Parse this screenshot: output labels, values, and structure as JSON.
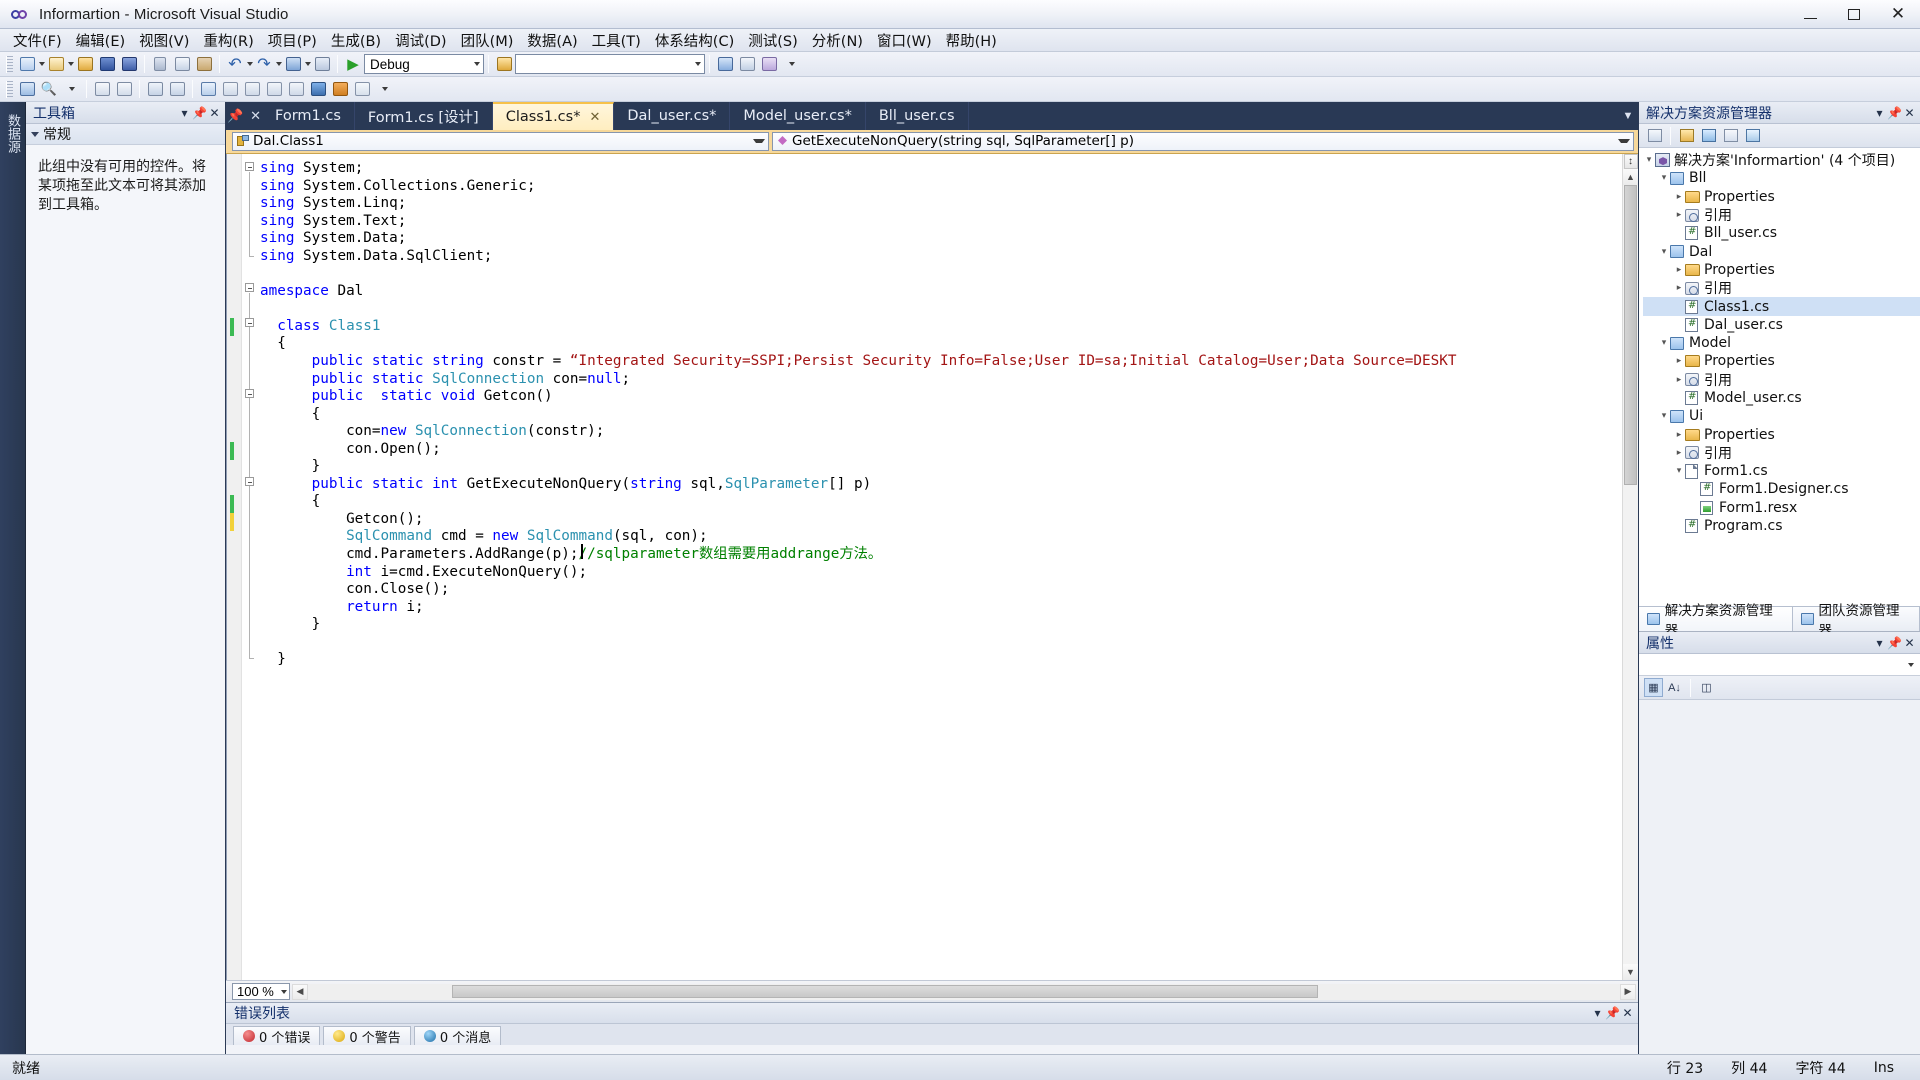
{
  "titlebar": {
    "title": "Informartion - Microsoft Visual Studio",
    "icon": "vs-logo-icon",
    "minimize": "—",
    "maximize": "☐",
    "close": "✕"
  },
  "menubar": {
    "items": [
      {
        "label": "文件(F)",
        "name": "menu-file"
      },
      {
        "label": "编辑(E)",
        "name": "menu-edit"
      },
      {
        "label": "视图(V)",
        "name": "menu-view"
      },
      {
        "label": "重构(R)",
        "name": "menu-refactor"
      },
      {
        "label": "项目(P)",
        "name": "menu-project"
      },
      {
        "label": "生成(B)",
        "name": "menu-build"
      },
      {
        "label": "调试(D)",
        "name": "menu-debug"
      },
      {
        "label": "团队(M)",
        "name": "menu-team"
      },
      {
        "label": "数据(A)",
        "name": "menu-data"
      },
      {
        "label": "工具(T)",
        "name": "menu-tools"
      },
      {
        "label": "体系结构(C)",
        "name": "menu-architecture"
      },
      {
        "label": "测试(S)",
        "name": "menu-test"
      },
      {
        "label": "分析(N)",
        "name": "menu-analyze"
      },
      {
        "label": "窗口(W)",
        "name": "menu-window"
      },
      {
        "label": "帮助(H)",
        "name": "menu-help"
      }
    ]
  },
  "toolbar": {
    "config_value": "Debug",
    "find_value": "",
    "run_label": "▶"
  },
  "toolbox": {
    "title": "工具箱",
    "section": "常规",
    "message": "此组中没有可用的控件。将某项拖至此文本可将其添加到工具箱。",
    "vtab_label": "数据源"
  },
  "editor": {
    "tabs": [
      {
        "label": "Form1.cs",
        "active": false,
        "closable": false
      },
      {
        "label": "Form1.cs [设计]",
        "active": false,
        "closable": false
      },
      {
        "label": "Class1.cs*",
        "active": true,
        "closable": true
      },
      {
        "label": "Dal_user.cs*",
        "active": false,
        "closable": false
      },
      {
        "label": "Model_user.cs*",
        "active": false,
        "closable": false
      },
      {
        "label": "Bll_user.cs",
        "active": false,
        "closable": false
      }
    ],
    "nav_class": "Dal.Class1",
    "nav_member": "GetExecuteNonQuery(string sql, SqlParameter[] p)",
    "zoom": "100 %",
    "close_tab_glyph": "✕",
    "overflow_glyph": "▼"
  },
  "code": {
    "lines": [
      {
        "seg": [
          {
            "t": "sing ",
            "c": "k"
          },
          {
            "t": "System;",
            "c": ""
          }
        ]
      },
      {
        "seg": [
          {
            "t": "sing ",
            "c": "k"
          },
          {
            "t": "System.Collections.Generic;",
            "c": ""
          }
        ]
      },
      {
        "seg": [
          {
            "t": "sing ",
            "c": "k"
          },
          {
            "t": "System.Linq;",
            "c": ""
          }
        ]
      },
      {
        "seg": [
          {
            "t": "sing ",
            "c": "k"
          },
          {
            "t": "System.Text;",
            "c": ""
          }
        ]
      },
      {
        "seg": [
          {
            "t": "sing ",
            "c": "k"
          },
          {
            "t": "System.Data;",
            "c": ""
          }
        ]
      },
      {
        "seg": [
          {
            "t": "sing ",
            "c": "k"
          },
          {
            "t": "System.Data.SqlClient;",
            "c": ""
          }
        ]
      },
      {
        "seg": []
      },
      {
        "seg": [
          {
            "t": "amespace ",
            "c": "k"
          },
          {
            "t": "Dal",
            "c": ""
          }
        ]
      },
      {
        "seg": []
      },
      {
        "seg": [
          {
            "t": "  class ",
            "c": "k"
          },
          {
            "t": "Class1",
            "c": "t"
          }
        ]
      },
      {
        "seg": [
          {
            "t": "  {",
            "c": ""
          }
        ]
      },
      {
        "seg": [
          {
            "t": "      public static string ",
            "c": "k"
          },
          {
            "t": "constr = ",
            "c": ""
          },
          {
            "t": "“Integrated Security=SSPI;Persist Security Info=False;User ID=sa;Initial Catalog=User;Data Source=DESKT",
            "c": "s"
          }
        ]
      },
      {
        "seg": [
          {
            "t": "      public static ",
            "c": "k"
          },
          {
            "t": "SqlConnection ",
            "c": "t"
          },
          {
            "t": "con=",
            "c": ""
          },
          {
            "t": "null",
            "c": "k"
          },
          {
            "t": ";",
            "c": ""
          }
        ]
      },
      {
        "seg": [
          {
            "t": "      public  static void ",
            "c": "k"
          },
          {
            "t": "Getcon()",
            "c": ""
          }
        ]
      },
      {
        "seg": [
          {
            "t": "      {",
            "c": ""
          }
        ]
      },
      {
        "seg": [
          {
            "t": "          con=",
            "c": ""
          },
          {
            "t": "new ",
            "c": "k"
          },
          {
            "t": "SqlConnection",
            "c": "t"
          },
          {
            "t": "(constr);",
            "c": ""
          }
        ]
      },
      {
        "seg": [
          {
            "t": "          con.Open();",
            "c": ""
          }
        ]
      },
      {
        "seg": [
          {
            "t": "      }",
            "c": ""
          }
        ]
      },
      {
        "seg": [
          {
            "t": "      public static int ",
            "c": "k"
          },
          {
            "t": "GetExecuteNonQuery(",
            "c": ""
          },
          {
            "t": "string ",
            "c": "k"
          },
          {
            "t": "sql,",
            "c": ""
          },
          {
            "t": "SqlParameter",
            "c": "t"
          },
          {
            "t": "[] p)",
            "c": ""
          }
        ]
      },
      {
        "seg": [
          {
            "t": "      {",
            "c": ""
          }
        ]
      },
      {
        "seg": [
          {
            "t": "          Getcon();",
            "c": ""
          }
        ]
      },
      {
        "seg": [
          {
            "t": "          ",
            "c": ""
          },
          {
            "t": "SqlCommand ",
            "c": "t"
          },
          {
            "t": "cmd = ",
            "c": ""
          },
          {
            "t": "new ",
            "c": "k"
          },
          {
            "t": "SqlCommand",
            "c": "t"
          },
          {
            "t": "(sql, con);",
            "c": ""
          }
        ]
      },
      {
        "seg": [
          {
            "t": "          cmd.Parameters.AddRange(p);",
            "c": ""
          },
          {
            "t": "//sqlparameter数组需要用addrange方法。",
            "c": "c"
          }
        ]
      },
      {
        "seg": [
          {
            "t": "          ",
            "c": ""
          },
          {
            "t": "int ",
            "c": "k"
          },
          {
            "t": "i=cmd.ExecuteNonQuery();",
            "c": ""
          }
        ]
      },
      {
        "seg": [
          {
            "t": "          con.Close();",
            "c": ""
          }
        ]
      },
      {
        "seg": [
          {
            "t": "          ",
            "c": ""
          },
          {
            "t": "return ",
            "c": "k"
          },
          {
            "t": "i;",
            "c": ""
          }
        ]
      },
      {
        "seg": [
          {
            "t": "      }",
            "c": ""
          }
        ]
      },
      {
        "seg": []
      },
      {
        "seg": [
          {
            "t": "  }",
            "c": ""
          }
        ]
      }
    ]
  },
  "errorlist": {
    "title": "错误列表",
    "tabs": [
      {
        "label": "0 个错误",
        "dot": "r",
        "name": "errors-tab"
      },
      {
        "label": "0 个警告",
        "dot": "y",
        "name": "warnings-tab"
      },
      {
        "label": "0 个消息",
        "dot": "b",
        "name": "messages-tab"
      }
    ]
  },
  "solution_explorer": {
    "title": "解决方案资源管理器",
    "root": "解决方案'Informartion' (4 个项目)",
    "nodes": [
      {
        "label": "解决方案'Informartion' (4 个项目)",
        "depth": 0,
        "exp": "−",
        "icon": "solution-icon",
        "sel": false
      },
      {
        "label": "Bll",
        "depth": 1,
        "exp": "−",
        "icon": "project-icon",
        "sel": false
      },
      {
        "label": "Properties",
        "depth": 2,
        "exp": "+",
        "icon": "folder-icon",
        "sel": false
      },
      {
        "label": "引用",
        "depth": 2,
        "exp": "+",
        "icon": "references-icon",
        "sel": false
      },
      {
        "label": "Bll_user.cs",
        "depth": 2,
        "exp": "",
        "icon": "csharp-file-icon",
        "sel": false
      },
      {
        "label": "Dal",
        "depth": 1,
        "exp": "−",
        "icon": "project-icon",
        "sel": false
      },
      {
        "label": "Properties",
        "depth": 2,
        "exp": "+",
        "icon": "folder-icon",
        "sel": false
      },
      {
        "label": "引用",
        "depth": 2,
        "exp": "+",
        "icon": "references-icon",
        "sel": false
      },
      {
        "label": "Class1.cs",
        "depth": 2,
        "exp": "",
        "icon": "csharp-file-icon",
        "sel": true
      },
      {
        "label": "Dal_user.cs",
        "depth": 2,
        "exp": "",
        "icon": "csharp-file-icon",
        "sel": false
      },
      {
        "label": "Model",
        "depth": 1,
        "exp": "−",
        "icon": "project-icon",
        "sel": false
      },
      {
        "label": "Properties",
        "depth": 2,
        "exp": "+",
        "icon": "folder-icon",
        "sel": false
      },
      {
        "label": "引用",
        "depth": 2,
        "exp": "+",
        "icon": "references-icon",
        "sel": false
      },
      {
        "label": "Model_user.cs",
        "depth": 2,
        "exp": "",
        "icon": "csharp-file-icon",
        "sel": false
      },
      {
        "label": "Ui",
        "depth": 1,
        "exp": "−",
        "icon": "project-icon",
        "sel": false
      },
      {
        "label": "Properties",
        "depth": 2,
        "exp": "+",
        "icon": "folder-icon",
        "sel": false
      },
      {
        "label": "引用",
        "depth": 2,
        "exp": "+",
        "icon": "references-icon",
        "sel": false
      },
      {
        "label": "Form1.cs",
        "depth": 2,
        "exp": "−",
        "icon": "form-file-icon",
        "sel": false
      },
      {
        "label": "Form1.Designer.cs",
        "depth": 3,
        "exp": "",
        "icon": "csharp-file-icon",
        "sel": false
      },
      {
        "label": "Form1.resx",
        "depth": 3,
        "exp": "",
        "icon": "resx-file-icon",
        "sel": false
      },
      {
        "label": "Program.cs",
        "depth": 2,
        "exp": "",
        "icon": "csharp-file-icon",
        "sel": false
      }
    ],
    "bottom_tabs": [
      {
        "label": "解决方案资源管理器",
        "active": true,
        "name": "solution-explorer-tab"
      },
      {
        "label": "团队资源管理器",
        "active": false,
        "name": "team-explorer-tab"
      }
    ]
  },
  "properties": {
    "title": "属性"
  },
  "statusbar": {
    "ready": "就绪",
    "line_label": "行 23",
    "col_label": "列 44",
    "char_label": "字符 44",
    "insert_label": "Ins"
  },
  "colors": {
    "accent_tab": "#f6c14a",
    "navbar": "#f7d89a",
    "chrome_dark": "#293955",
    "keyword": "#0000ff",
    "type": "#2b91af",
    "string": "#a31515",
    "comment": "#008000"
  }
}
